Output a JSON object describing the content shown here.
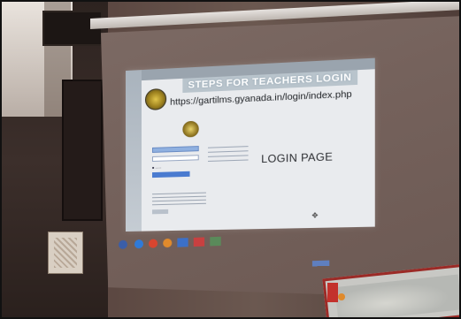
{
  "slide": {
    "title": "STEPS FOR TEACHERS LOGIN",
    "url": "https://gartilms.gyanada.in/login/index.php",
    "heading": "LOGIN PAGE"
  },
  "colors": {
    "slide_background": "#e9ebee",
    "login_button": "#4a7bd0",
    "screen": "#75625c"
  },
  "taskbar": {
    "icons": [
      "windows-start-icon",
      "browser-icon",
      "chrome-icon",
      "firefox-icon",
      "folder-icon",
      "media-icon",
      "app-icon"
    ]
  }
}
